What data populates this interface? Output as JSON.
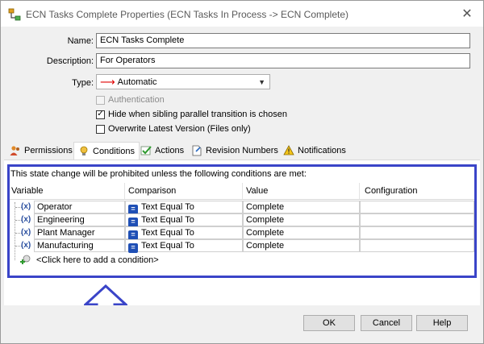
{
  "window": {
    "title": "ECN Tasks Complete Properties (ECN Tasks In Process -> ECN Complete)",
    "close_glyph": "✕"
  },
  "form": {
    "name_label": "Name:",
    "name_value": "ECN Tasks Complete",
    "description_label": "Description:",
    "description_value": "For Operators",
    "type_label": "Type:",
    "type_value": "Automatic",
    "authentication_label": "Authentication",
    "authentication_checked": false,
    "hide_label": "Hide when sibling parallel transition is chosen",
    "hide_checked": true,
    "overwrite_label": "Overwrite Latest Version (Files only)",
    "overwrite_checked": false
  },
  "tabs": [
    {
      "label": "Permissions",
      "icon": "users-icon",
      "active": false
    },
    {
      "label": "Conditions",
      "icon": "conditions-icon",
      "active": true
    },
    {
      "label": "Actions",
      "icon": "check-icon",
      "active": false
    },
    {
      "label": "Revision Numbers",
      "icon": "revision-icon",
      "active": false
    },
    {
      "label": "Notifications",
      "icon": "bell-icon",
      "active": false
    }
  ],
  "conditions": {
    "notice": "This state change will be prohibited unless the following conditions are met:",
    "columns": [
      "Variable",
      "Comparison",
      "Value",
      "Configuration"
    ],
    "rows": [
      {
        "variable": "Operator",
        "comparison": "Text Equal To",
        "value": "Complete",
        "configuration": ""
      },
      {
        "variable": "Engineering",
        "comparison": "Text Equal To",
        "value": "Complete",
        "configuration": ""
      },
      {
        "variable": "Plant Manager",
        "comparison": "Text Equal To",
        "value": "Complete",
        "configuration": ""
      },
      {
        "variable": "Manufacturing",
        "comparison": "Text Equal To",
        "value": "Complete",
        "configuration": ""
      }
    ],
    "add_label": "<Click here to add a condition>",
    "variable_glyph": "(x)",
    "comparison_glyph": "="
  },
  "buttons": {
    "ok": "OK",
    "cancel": "Cancel",
    "help": "Help"
  },
  "colors": {
    "highlight": "#3a44c8",
    "type_arrow": "#e00000",
    "comparison_icon": "#1f4fb5"
  }
}
